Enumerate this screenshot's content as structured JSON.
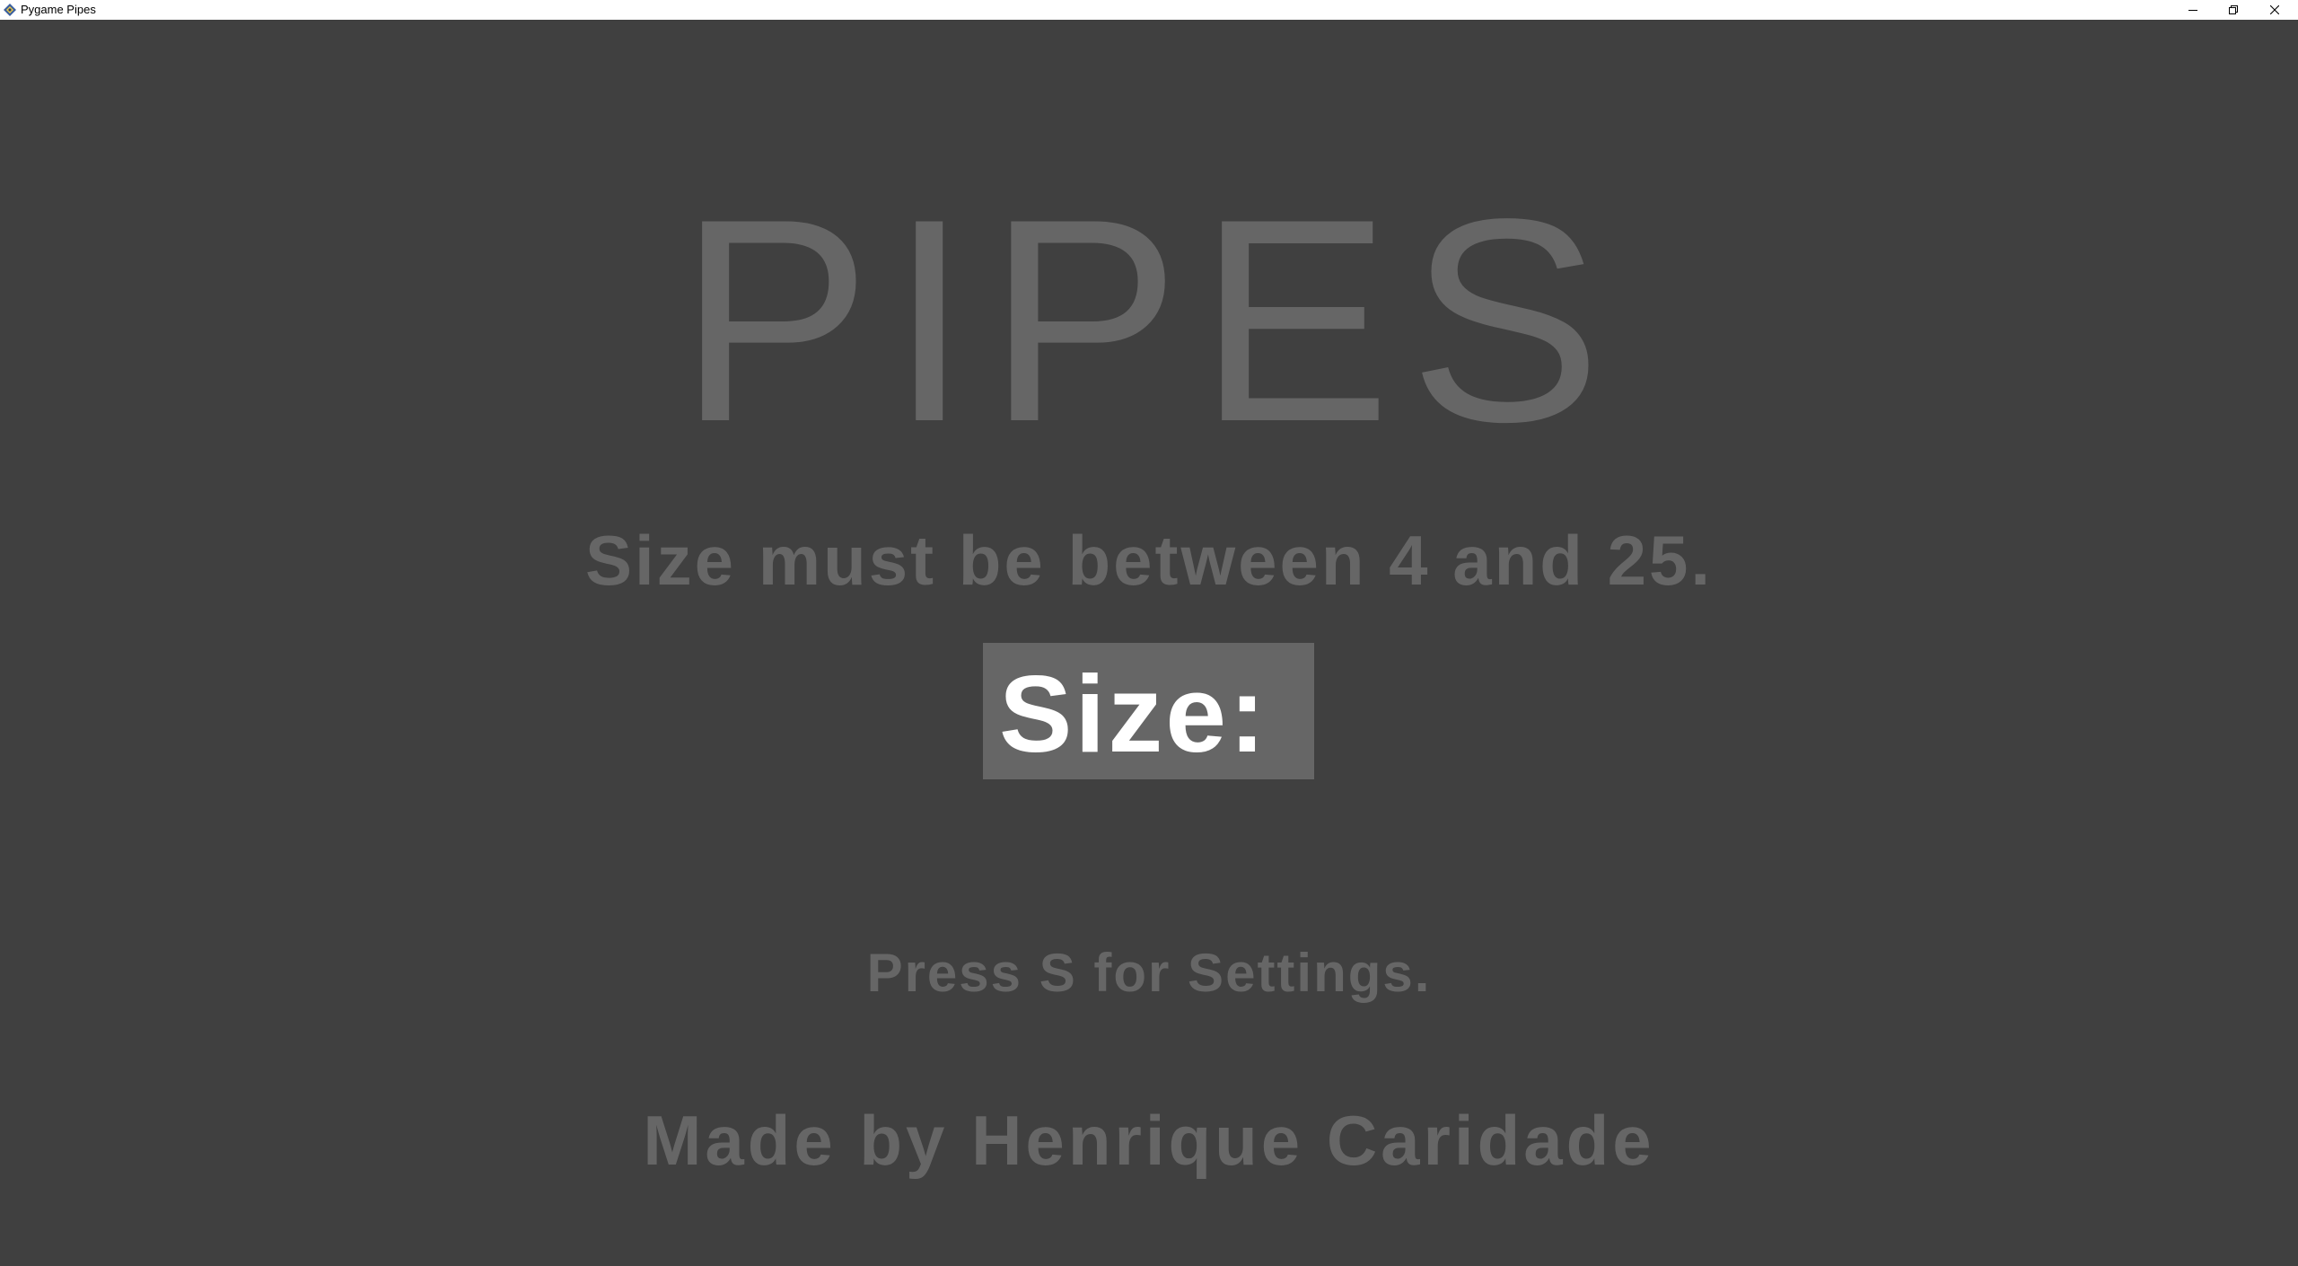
{
  "window": {
    "title": "Pygame Pipes",
    "icon": "pygame-icon",
    "controls": [
      "minimize-icon",
      "restore-icon",
      "close-icon"
    ]
  },
  "game": {
    "title": "PIPES",
    "hint": "Size must be between 4 and 25.",
    "size_field": {
      "label": "Size:",
      "value": ""
    },
    "settings_hint": "Press S for Settings.",
    "credits": "Made by Henrique Caridade"
  },
  "colors": {
    "background": "#404040",
    "text": "#666666",
    "input_background": "#666666",
    "input_text": "#ffffff"
  }
}
